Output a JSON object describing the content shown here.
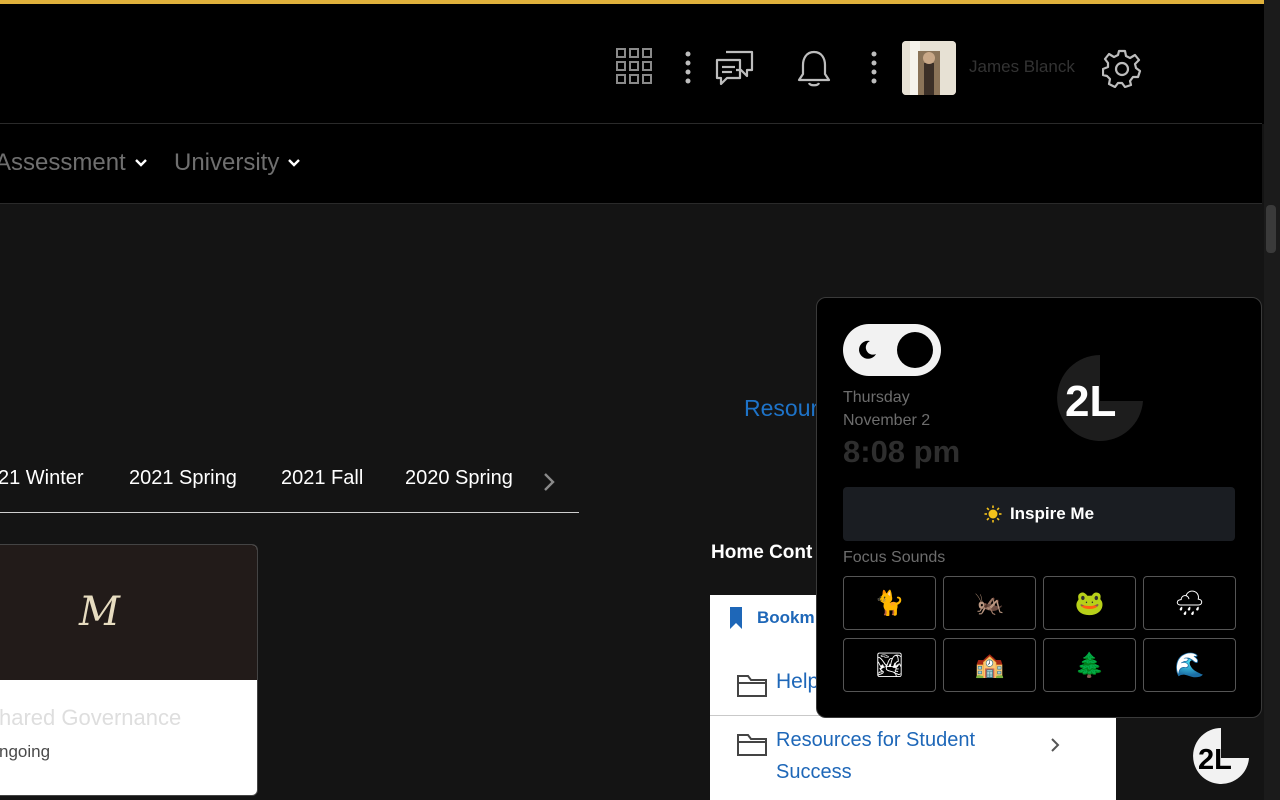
{
  "header": {
    "user_name": "James Blanck",
    "accent": "#e0b13b"
  },
  "nav": {
    "items": [
      "Assessment",
      "University"
    ]
  },
  "page": {
    "resources_link": "Resour",
    "term_tabs": [
      "21 Winter",
      "2021 Spring",
      "2021 Fall",
      "2020 Spring"
    ],
    "course_card": {
      "logo_text": "M",
      "title": "hared Governance",
      "status": "ngoing"
    },
    "home_content": {
      "title": "Home Cont",
      "bookmark_label": "Bookm",
      "items": [
        "Help",
        "Resources for Student Success"
      ]
    }
  },
  "widget": {
    "day": "Thursday",
    "date": "November 2",
    "time": "8:08 pm",
    "brand": "2L",
    "inspire_label": "Inspire Me",
    "focus_title": "Focus Sounds",
    "sounds": [
      {
        "icon": "cat-icon",
        "glyph": "🐈"
      },
      {
        "icon": "cricket-icon",
        "glyph": "🦗"
      },
      {
        "icon": "frog-icon",
        "glyph": "🐸"
      },
      {
        "icon": "rain-cloud-icon",
        "glyph": "🌧"
      },
      {
        "icon": "landscape-icon",
        "glyph": "🏞"
      },
      {
        "icon": "building-icon",
        "glyph": "🏫"
      },
      {
        "icon": "pine-tree-icon",
        "glyph": "🌲"
      },
      {
        "icon": "wave-icon",
        "glyph": "🌊"
      }
    ]
  }
}
